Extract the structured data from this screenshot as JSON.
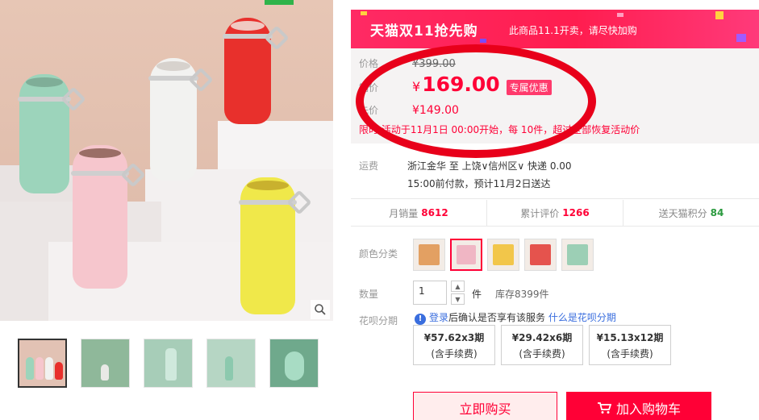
{
  "promo": {
    "event_logo": "天猫双11抢先购",
    "notice": "此商品11.1开卖，请尽快加购"
  },
  "price": {
    "original_label": "价格",
    "original_value": "¥399.00",
    "promo_label": "销价",
    "currency": "¥",
    "promo_value": "169.00",
    "exclusive_tag": "专属优惠",
    "presale_label": "先价",
    "presale_value": "¥149.00",
    "limit_text": "限时    活动于11月1日 00:00开始，每    10件，超过全部恢复活动价"
  },
  "shipping": {
    "label": "运费",
    "route": "浙江金华 至 上饶∨信州区∨ 快递 0.00",
    "delivery": "15:00前付款，预计11月2日送达"
  },
  "stats": [
    {
      "label": "月销量",
      "value": "8612",
      "color": "#ff0036"
    },
    {
      "label": "累计评价",
      "value": "1266",
      "color": "#ff0036"
    },
    {
      "label": "送天猫积分",
      "value": "84",
      "color": "#2a9a3e"
    }
  ],
  "color_options": {
    "label": "颜色分类",
    "swatches": [
      {
        "name": "orange",
        "color": "#e3a062"
      },
      {
        "name": "pink",
        "color": "#f0b6c4",
        "selected": true
      },
      {
        "name": "yellow",
        "color": "#f2c64a"
      },
      {
        "name": "red",
        "color": "#e5534d"
      },
      {
        "name": "green",
        "color": "#9ccfb5"
      }
    ]
  },
  "quantity": {
    "label": "数量",
    "value": "1",
    "unit": "件",
    "stock": "库存8399件"
  },
  "installment": {
    "label": "花呗分期",
    "login_link": "登录",
    "notice": "后确认是否享有该服务",
    "what_link": "什么是花呗分期",
    "plans": [
      {
        "amount": "¥57.62x3期",
        "fee": "(含手续费)"
      },
      {
        "amount": "¥29.42x6期",
        "fee": "(含手续费)"
      },
      {
        "amount": "¥15.13x12期",
        "fee": "(含手续费)"
      }
    ]
  },
  "actions": {
    "buy_now": "立即购买",
    "add_to_cart": "加入购物车"
  },
  "colors": {
    "accent": "#ff0036",
    "highlight_circle": "#e8001a"
  }
}
